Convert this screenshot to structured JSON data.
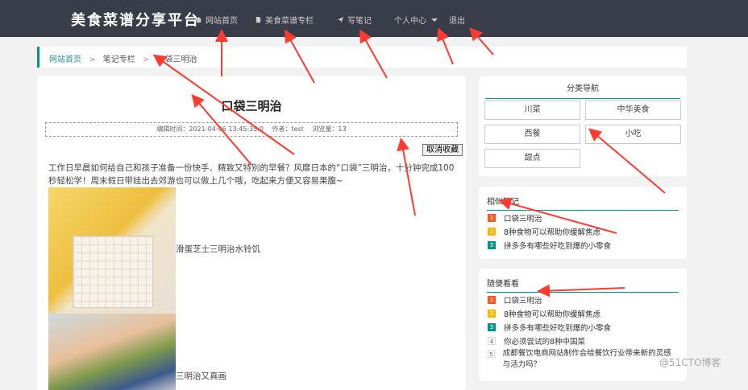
{
  "header": {
    "brand": "美食菜谱分享平台",
    "nav": [
      {
        "label": "网站首页",
        "icon": "home-icon"
      },
      {
        "label": "美食菜谱专栏",
        "icon": "document-icon"
      },
      {
        "label": "写笔记",
        "icon": "send-icon"
      },
      {
        "label": "个人中心",
        "icon": "chevron-down-icon"
      },
      {
        "label": "退出",
        "icon": ""
      }
    ]
  },
  "breadcrumb": {
    "home": "网站首页",
    "section": "笔记专栏",
    "current": "口袋三明治",
    "separator": ">"
  },
  "article": {
    "title": "口袋三明治",
    "edit_time": "编辑时间：2021-04-06 13:45:35.0",
    "author": "作者：test",
    "views": "浏览量：13",
    "cancel_button": "取消收藏",
    "intro": "工作日早晨如何给自己和孩子准备一份快手、精致又特别的早餐？风靡日本的“口袋”三明治，十分钟完成100秒轻松学！周末假日带娃出去郊游也可以做上几个哦，吃起来方便又容易果腹~",
    "caption_1": "滑蛋芝士三明治水铃饥",
    "caption_2": "三明治又真画"
  },
  "category": {
    "title": "分类导航",
    "items": [
      "川菜",
      "中华美食",
      "西餐",
      "小吃",
      "甜点"
    ]
  },
  "related": {
    "title": "相似笔记",
    "items": [
      "口袋三明治",
      "8种食物可以帮助你缓解焦虑",
      "拼多多有哪些好吃到爆的小零食"
    ]
  },
  "random": {
    "title": "随便看看",
    "items": [
      "口袋三明治",
      "8种食物可以帮助你缓解焦虑",
      "拼多多有哪些好吃到爆的小零食",
      "你必须尝试的8种中国菜",
      "成都餐饮电商网站制作会给餐饮行业带来新的灵感与活力吗？"
    ]
  },
  "watermark": "@51CTO博客",
  "colors": {
    "topbar": "#393d49",
    "accent": "#009688",
    "annotation": "#ff3b30"
  }
}
